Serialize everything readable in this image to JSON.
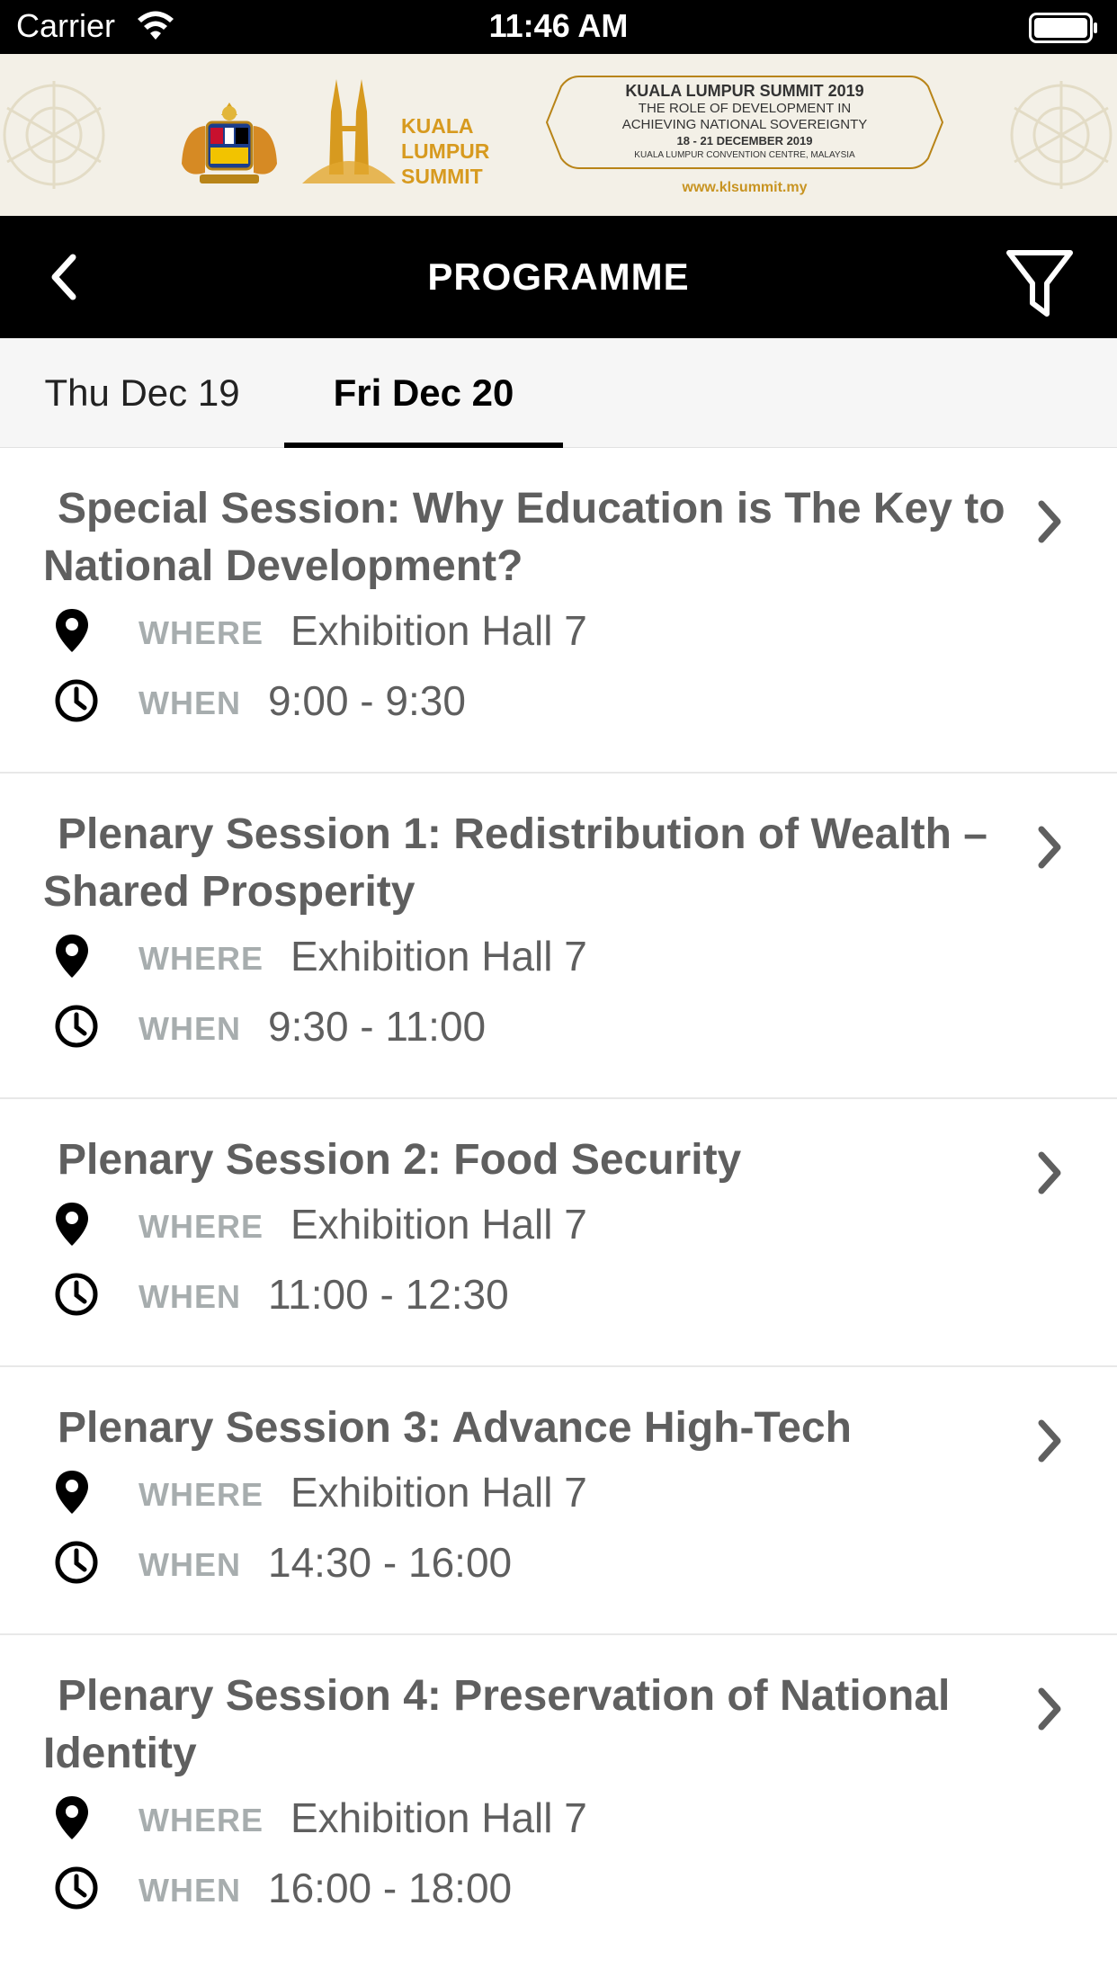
{
  "status_bar": {
    "carrier": "Carrier",
    "time": "11:46 AM"
  },
  "banner": {
    "brand_line1": "KUALA",
    "brand_line2": "LUMPUR",
    "brand_line3": "SUMMIT",
    "summit_title": "KUALA LUMPUR SUMMIT 2019",
    "summit_sub1": "THE ROLE OF DEVELOPMENT IN",
    "summit_sub2": "ACHIEVING NATIONAL SOVEREIGNTY",
    "summit_dates": "18 - 21 DECEMBER 2019",
    "summit_venue": "KUALA LUMPUR CONVENTION CENTRE, MALAYSIA",
    "summit_url": "www.klsummit.my",
    "accent_color": "#d79a1f"
  },
  "navbar": {
    "title": "PROGRAMME"
  },
  "tabs": [
    {
      "label": "Thu Dec 19",
      "selected": false
    },
    {
      "label": "Fri Dec 20",
      "selected": true
    }
  ],
  "labels": {
    "where": "WHERE",
    "when": "WHEN"
  },
  "sessions": [
    {
      "title": "Special Session: Why Education is The Key to National Development?",
      "where": "Exhibition Hall 7",
      "when": "9:00 - 9:30"
    },
    {
      "title": "Plenary Session 1: Redistribution of Wealth – Shared Prosperity",
      "where": "Exhibition Hall 7",
      "when": "9:30 - 11:00"
    },
    {
      "title": "Plenary Session 2: Food Security",
      "where": "Exhibition Hall 7",
      "when": "11:00 - 12:30"
    },
    {
      "title": "Plenary Session 3: Advance High-Tech",
      "where": "Exhibition Hall 7",
      "when": "14:30 - 16:00"
    },
    {
      "title": "Plenary Session 4: Preservation of National Identity",
      "where": "Exhibition Hall 7",
      "when": "16:00 - 18:00"
    }
  ]
}
